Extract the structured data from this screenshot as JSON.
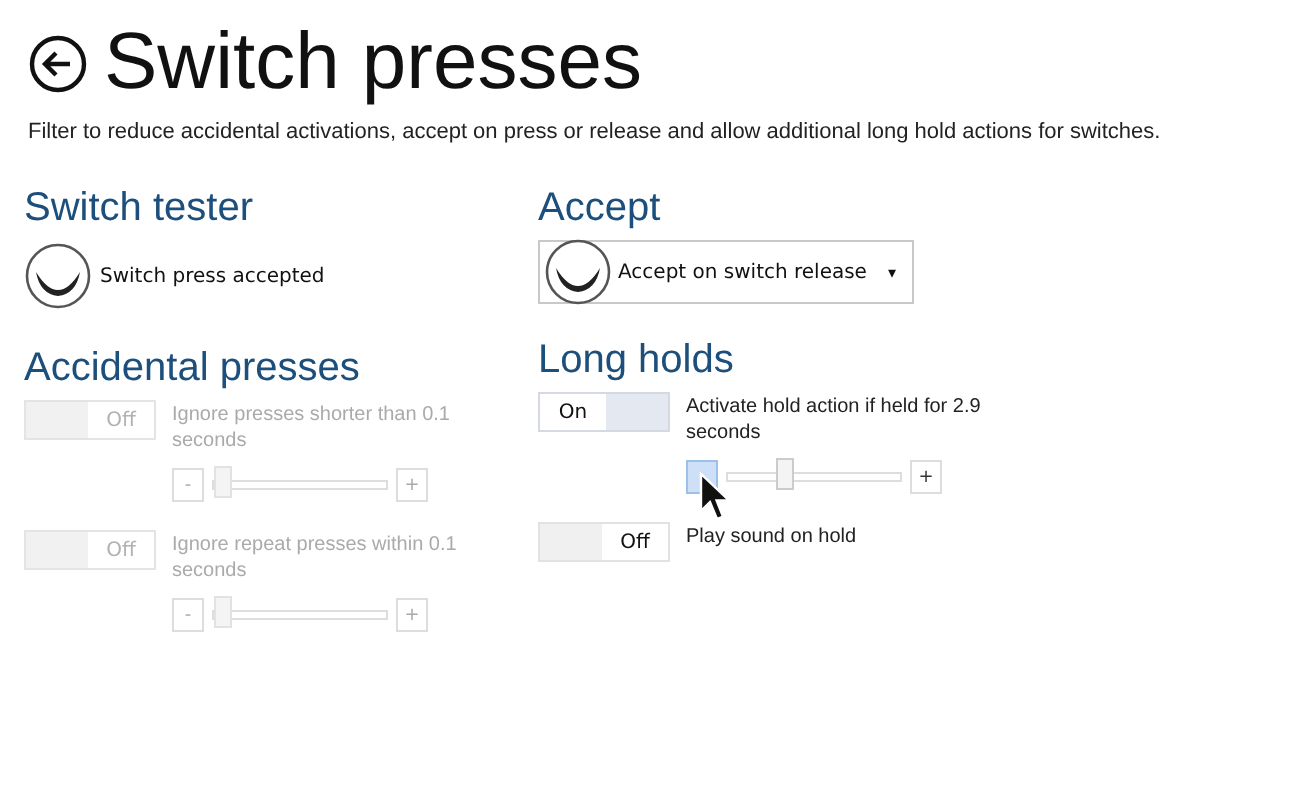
{
  "title": "Switch presses",
  "subtitle": "Filter to reduce accidental activations, accept on press or release and allow additional long hold actions for switches.",
  "switch_tester": {
    "heading": "Switch tester",
    "status": "Switch press accepted"
  },
  "accept": {
    "heading": "Accept",
    "dropdown": {
      "value": "Accept on switch release",
      "caret": "▾"
    }
  },
  "accidental_presses": {
    "heading": "Accidental presses",
    "options": [
      {
        "label": "Ignore presses shorter than 0.1 seconds",
        "disabled": true,
        "toggle": {
          "on": false,
          "label": "Off"
        },
        "slider": {
          "level": 0,
          "minus": "-",
          "plus": "+",
          "minus_pressed": false
        }
      },
      {
        "label": "Ignore repeat presses within 0.1 seconds",
        "disabled": true,
        "toggle": {
          "on": false,
          "label": "Off"
        },
        "slider": {
          "level": 0,
          "minus": "-",
          "plus": "+",
          "minus_pressed": false
        }
      }
    ]
  },
  "long_holds": {
    "heading": "Long holds",
    "options": [
      {
        "label": "Activate hold action if held for 2.9 seconds",
        "disabled": false,
        "toggle": {
          "on": true,
          "label": "On"
        },
        "slider": {
          "level": 0.28,
          "plus": "+",
          "minus_pressed": true
        }
      },
      {
        "label": "Play sound on hold",
        "disabled": false,
        "toggle": {
          "on": false,
          "label": "Off"
        }
      }
    ]
  }
}
